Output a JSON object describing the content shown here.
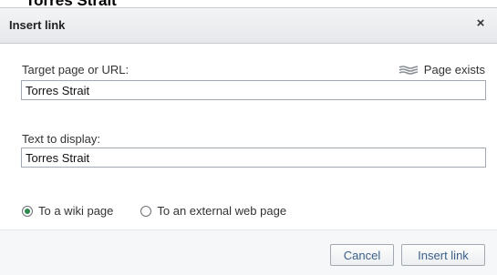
{
  "background_fragment": "Torres Strait",
  "dialog": {
    "title": "Insert link",
    "close_label": "×"
  },
  "target": {
    "label": "Target page or URL:",
    "value": "Torres Strait",
    "status_text": "Page exists",
    "status_icon": "page-exists-icon"
  },
  "display": {
    "label": "Text to display:",
    "value": "Torres Strait"
  },
  "link_type": {
    "options": [
      {
        "label": "To a wiki page",
        "checked": true
      },
      {
        "label": "To an external web page",
        "checked": false
      }
    ]
  },
  "buttons": {
    "cancel": "Cancel",
    "insert": "Insert link"
  },
  "colors": {
    "radio_checked": "#2c8a4a",
    "button_text": "#3a5f8a"
  }
}
